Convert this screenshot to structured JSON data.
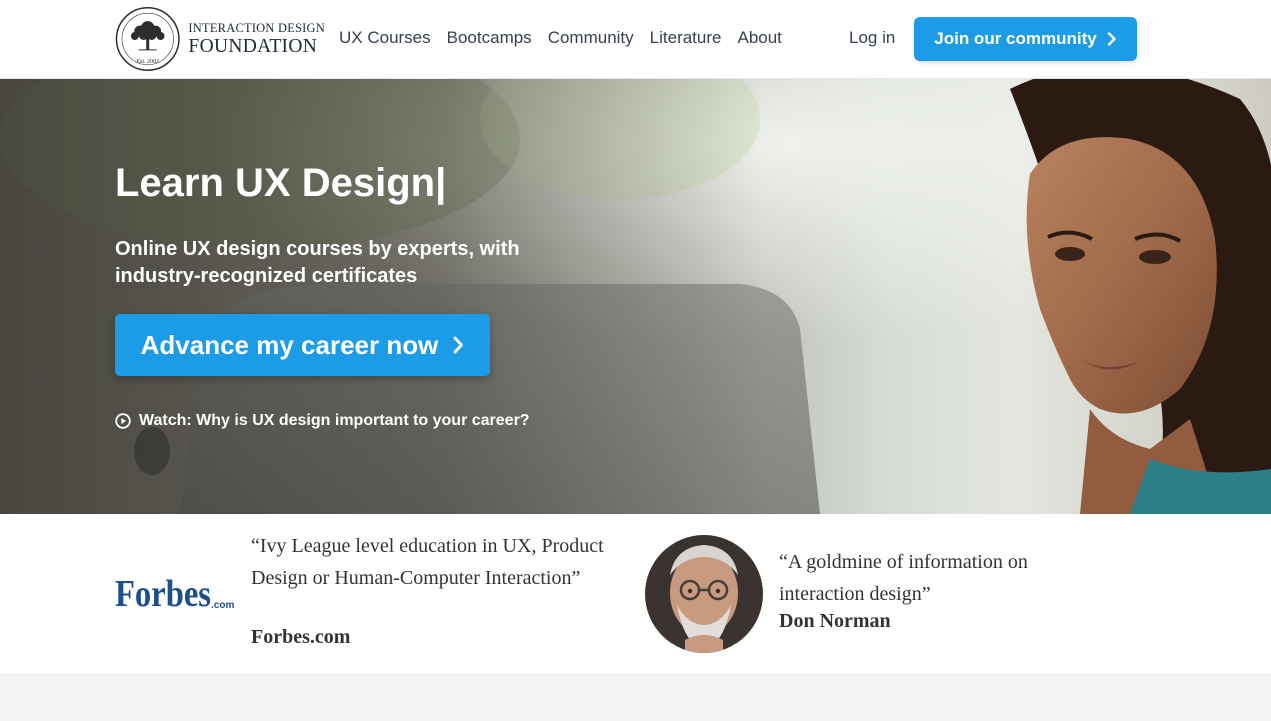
{
  "header": {
    "logo": {
      "line1": "INTERACTION DESIGN",
      "line2": "FOUNDATION",
      "seal_text": "Est. 2002",
      "icon": "tree-seal-icon"
    },
    "nav": [
      "UX Courses",
      "Bootcamps",
      "Community",
      "Literature",
      "About"
    ],
    "login_label": "Log in",
    "join_label": "Join our community"
  },
  "hero": {
    "title": "Learn UX Design|",
    "subtitle": "Online UX design courses by experts, with industry-recognized certificates",
    "cta_label": "Advance my career now",
    "watch_label": "Watch: Why is UX design important to your career?",
    "watch_icon": "play-circle-icon"
  },
  "testimonials": [
    {
      "quote": "“Ivy League level education in UX, Product Design or Human-Computer Interaction”",
      "source": "Forbes.com",
      "logo_text": "Forbes",
      "logo_subtext": ".com"
    },
    {
      "quote": "“A goldmine of information on interaction design”",
      "source": "Don Norman",
      "icon": "portrait-avatar"
    }
  ],
  "colors": {
    "accent": "#1c9ce7",
    "forbes_blue": "#1c4f8c",
    "text_dark": "#333333"
  }
}
